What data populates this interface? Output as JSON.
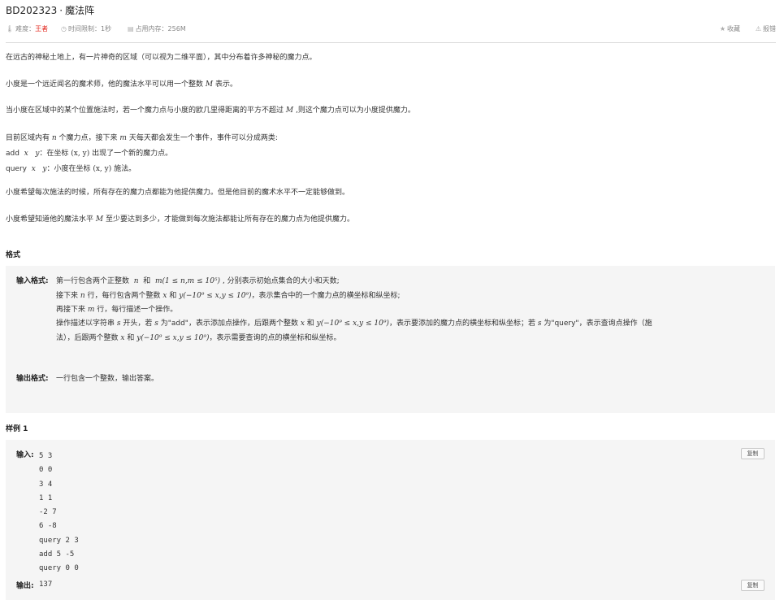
{
  "problem": {
    "id": "BD202323",
    "separator": "·",
    "name": "魔法阵"
  },
  "meta": {
    "difficulty_label": "难度：",
    "difficulty_value": "王者",
    "time_limit": "时间限制：1秒",
    "memory": "占用内存：256M",
    "collect": "收藏",
    "report": "报错"
  },
  "statement": {
    "p1": "在远古的神秘土地上，有一片神奇的区域（可以视为二维平面），其中分布着许多神秘的魔力点。",
    "p2a": "小度是一个远近闻名的魔术师，他的魔法水平可以用一个整数 ",
    "p2m": "M",
    "p2b": " 表示。",
    "p3a": "当小度在区域中的某个位置施法时，若一个魔力点与小度的欧几里得距离的平方不超过 ",
    "p3m": "M",
    "p3b": " ,则这个魔力点可以为小度提供魔力。",
    "p4a": "目前区域内有 ",
    "p4n": "n",
    "p4b": " 个魔力点，接下来 ",
    "p4m": "m",
    "p4c": " 天每天都会发生一个事件，事件可以分成两类:",
    "p5a": "add  ",
    "p5m": "x   y",
    "p5b": "：在坐标 ",
    "p5c": "(x, y)",
    "p5d": " 出现了一个新的魔力点。",
    "p6a": "query  ",
    "p6m": "x   y",
    "p6b": "：小度在坐标 ",
    "p6c": "(x, y)",
    "p6d": " 施法。",
    "p7": "小度希望每次施法的时候，所有存在的魔力点都能为他提供魔力。但是他目前的魔术水平不一定能够做到。",
    "p8a": "小度希望知道他的魔法水平 ",
    "p8m": "M",
    "p8b": " 至少要达到多少，才能做到每次施法都能让所有存在的魔力点为他提供魔力。"
  },
  "format": {
    "heading": "格式",
    "input_label": "输入格式:",
    "l1a": "第一行包含两个正整数  ",
    "l1n": "n",
    "l1b": "  和  ",
    "l1c": "m(1 ≤ n,m ≤ 10⁵)",
    "l1d": " , 分别表示初始点集合的大小和天数;",
    "l2a": "接下来 ",
    "l2n": "n",
    "l2b": " 行，每行包含两个整数 ",
    "l2x": "x",
    "l2c": " 和 ",
    "l2y": "y(−10⁹ ≤ x,y ≤ 10⁹)",
    "l2d": "，表示集合中的一个魔力点的横坐标和纵坐标;",
    "l3a": "再接下来 ",
    "l3m": "m",
    "l3b": " 行，每行描述一个操作。",
    "l4a": "操作描述以字符串 ",
    "l4s": "s",
    "l4b": " 开头，若 ",
    "l4s2": "s",
    "l4c": " 为\"add\"，表示添加点操作，后跟两个整数 ",
    "l4x": "x",
    "l4d": " 和 ",
    "l4y": "y(−10⁹ ≤ x,y ≤ 10⁹)",
    "l4e": "，表示要添加的魔力点的横坐标和纵坐标；若 ",
    "l4s3": "s",
    "l4f": " 为\"query\"，表示查询点操作（施",
    "l5a": "法），后跟两个整数 ",
    "l5x": "x",
    "l5b": " 和 ",
    "l5y": "y(−10⁹ ≤ x,y ≤ 10⁹)",
    "l5c": "，表示需要查询的点的横坐标和纵坐标。",
    "output_label": "输出格式:",
    "output_text": "一行包含一个整数，输出答案。"
  },
  "sample": {
    "heading": "样例 1",
    "input_label": "输入:",
    "input_lines": [
      "5 3",
      "0 0",
      "3 4",
      "1 1",
      "-2 7",
      "6 -8",
      "query 2 3",
      "add 5 -5",
      "query 0 0"
    ],
    "output_label": "输出:",
    "output_value": "137",
    "copy_label": "复制"
  }
}
